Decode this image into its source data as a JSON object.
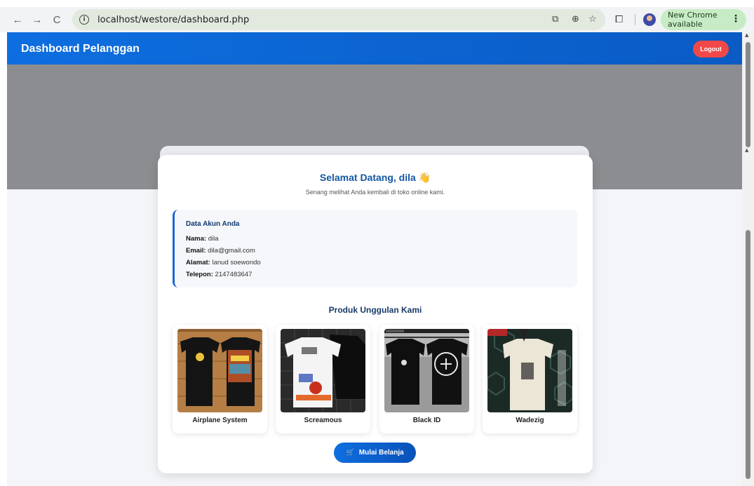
{
  "browser": {
    "back_icon": "←",
    "forward_icon": "→",
    "reload_icon": "C",
    "url": "localhost/westore/dashboard.php",
    "update_label": "New Chrome available"
  },
  "header": {
    "title": "Dashboard Pelanggan",
    "logout_label": "Logout"
  },
  "welcome": {
    "title": "Selamat Datang, dila",
    "emoji": "👋",
    "subtitle": "Senang melihat Anda kembali di toko online kami."
  },
  "account": {
    "title": "Data Akun Anda",
    "fields": [
      {
        "label": "Nama:",
        "value": "dila"
      },
      {
        "label": "Email:",
        "value": "dila@gmail.com"
      },
      {
        "label": "Alamat:",
        "value": "lanud soewondo"
      },
      {
        "label": "Telepon:",
        "value": "2147483647"
      }
    ]
  },
  "products": {
    "title": "Produk Unggulan Kami",
    "items": [
      {
        "name": "Airplane System"
      },
      {
        "name": "Screamous"
      },
      {
        "name": "Black ID"
      },
      {
        "name": "Wadezig"
      }
    ]
  },
  "shop_button": {
    "icon": "🛒",
    "label": "Mulai Belanja"
  },
  "colors": {
    "header_blue": "#0e6ee0",
    "logout_red": "#f04848",
    "accent_title": "#1457a3"
  }
}
